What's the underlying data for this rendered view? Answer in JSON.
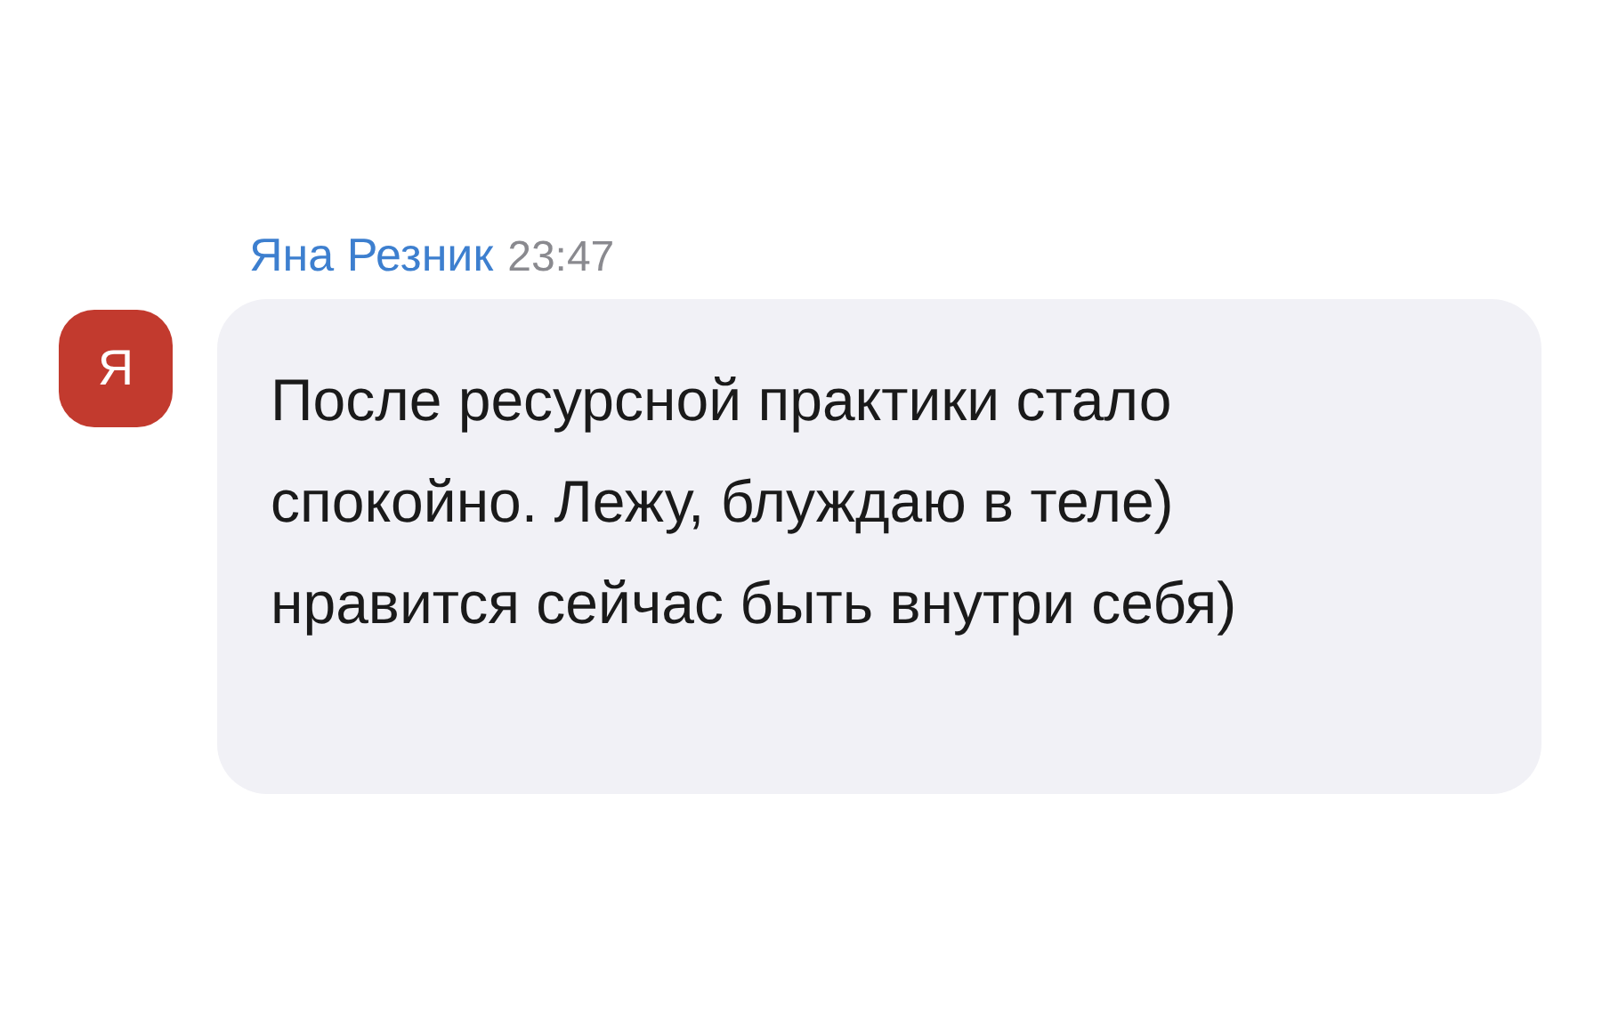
{
  "message": {
    "avatar": {
      "letter": "Я",
      "color": "#c23a2e"
    },
    "author": "Яна Резник",
    "time": "23:47",
    "text": "После ресурсной практики стало спокойно. Лежу, блуждаю в теле) нравится сейчас быть внутри себя)"
  }
}
